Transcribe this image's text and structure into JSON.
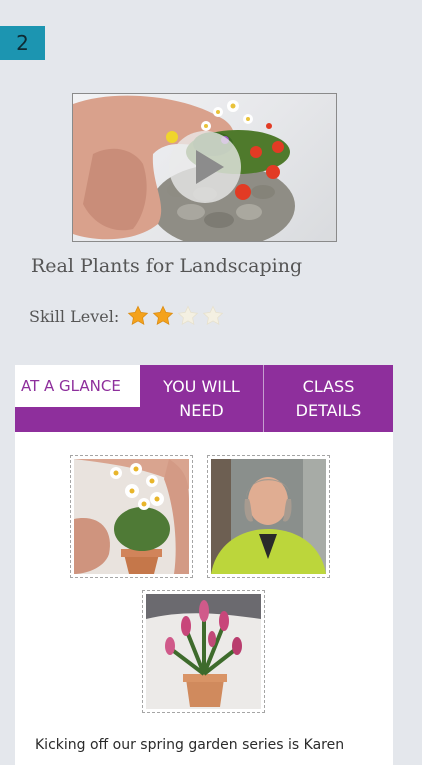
{
  "page_badge": "2",
  "video": {
    "caption_title": "Real Plants for Landscaping",
    "play_icon": "play-icon"
  },
  "skill": {
    "label": "Skill Level:",
    "rating": 2,
    "max": 5,
    "star_color": "#f4a21c"
  },
  "tabs": [
    {
      "label": "AT A GLANCE",
      "active": true
    },
    {
      "label": "YOU WILL NEED",
      "active": false
    },
    {
      "label": "CLASS DETAILS",
      "active": false
    }
  ],
  "description": "Kicking off our spring garden series is Karen",
  "colors": {
    "accent": "#8e2f9c",
    "badge": "#1c95b1",
    "background": "#e4e7ec"
  }
}
